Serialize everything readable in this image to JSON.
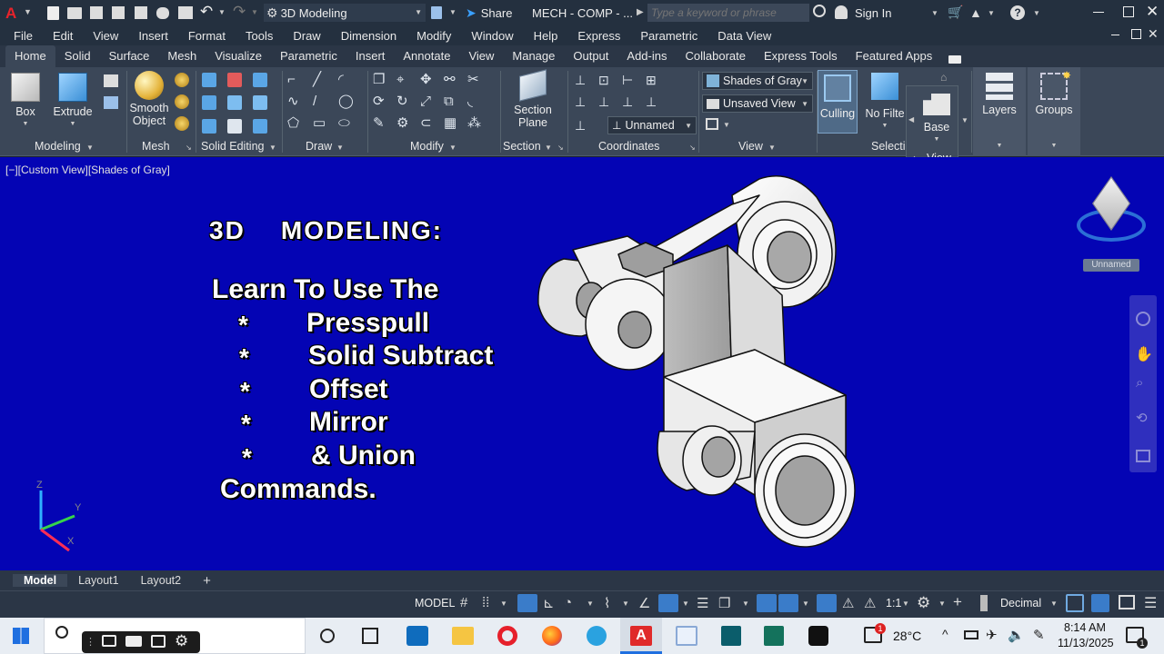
{
  "titlebar": {
    "workspace": "3D Modeling",
    "share": "Share",
    "doc_title": "MECH - COMP - ...",
    "search_placeholder": "Type a keyword or phrase",
    "sign_in": "Sign In",
    "help": "?"
  },
  "menu": [
    "File",
    "Edit",
    "View",
    "Insert",
    "Format",
    "Tools",
    "Draw",
    "Dimension",
    "Modify",
    "Window",
    "Help",
    "Express",
    "Parametric",
    "Data View"
  ],
  "ribbon_tabs": [
    "Home",
    "Solid",
    "Surface",
    "Mesh",
    "Visualize",
    "Parametric",
    "Insert",
    "Annotate",
    "View",
    "Manage",
    "Output",
    "Add-ins",
    "Collaborate",
    "Express Tools",
    "Featured Apps"
  ],
  "ribbon": {
    "box": "Box",
    "extrude": "Extrude",
    "smooth_object_1": "Smooth",
    "smooth_object_2": "Object",
    "section_plane_1": "Section",
    "section_plane_2": "Plane",
    "visual_style": "Shades of Gray",
    "view_saved": "Unsaved View",
    "ucs_named": "Unnamed",
    "culling": "Culling",
    "no_filter": "No Filte",
    "base_view_1": "Base",
    "base_view_2": "View",
    "layers": "Layers",
    "groups": "Groups",
    "panels": {
      "modeling": "Modeling",
      "mesh": "Mesh",
      "solid_editing": "Solid Editing",
      "draw": "Draw",
      "modify": "Modify",
      "section": "Section",
      "coordinates": "Coordinates",
      "view": "View",
      "selection": "Selecti"
    }
  },
  "viewport": {
    "label": "[−][Custom View][Shades of Gray]",
    "heading": "3D    MODELING:",
    "intro": "Learn To Use The",
    "bullets": [
      {
        "star": "*",
        "text": "Presspull"
      },
      {
        "star": "*",
        "text": "Solid Subtract"
      },
      {
        "star": "*",
        "text": "Offset"
      },
      {
        "star": "*",
        "text": "Mirror"
      },
      {
        "star": "*",
        "text": "& Union"
      }
    ],
    "closing": "Commands.",
    "viewcube_ucs": "Unnamed",
    "ucs_axes": {
      "x": "X",
      "y": "Y",
      "z": "Z"
    }
  },
  "layout_tabs": [
    "Model",
    "Layout1",
    "Layout2",
    "+"
  ],
  "statusbar": {
    "model": "MODEL",
    "scale": "1:1",
    "units": "Decimal"
  },
  "taskbar": {
    "temperature": "28°C",
    "time": "8:14 AM",
    "date": "11/13/2025",
    "notification_count": "1"
  },
  "colors": {
    "viewport_bg": "#0404b4",
    "ribbon_bg": "#3b4758",
    "accent": "#1e90ff"
  }
}
